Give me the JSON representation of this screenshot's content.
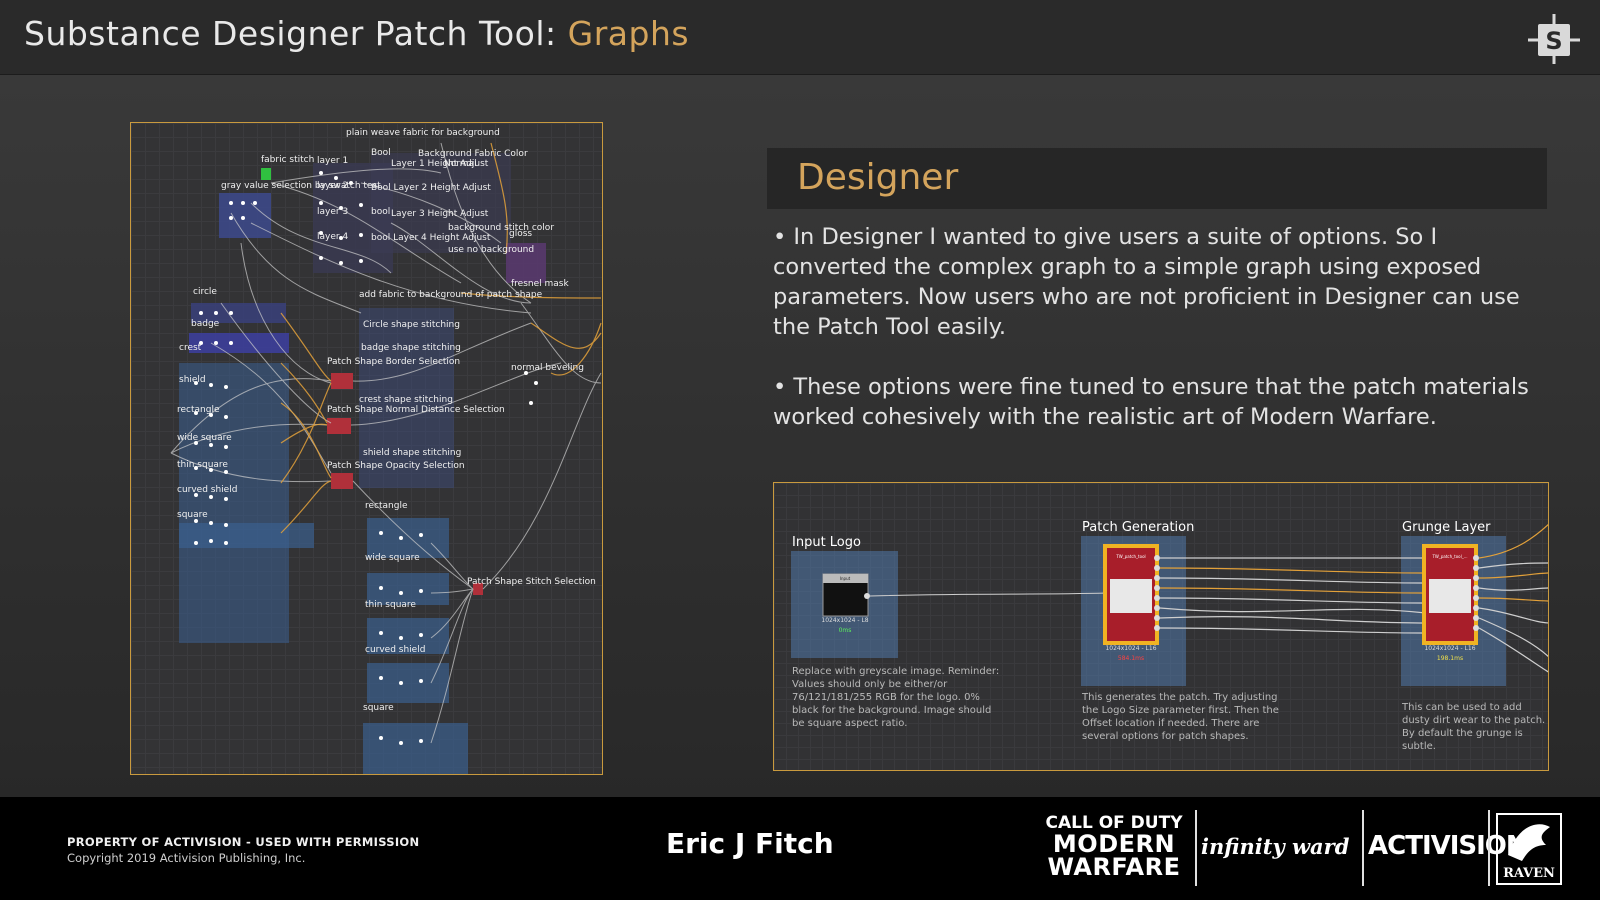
{
  "header": {
    "title_main": "Substance Designer Patch Tool: ",
    "title_accent": "Graphs",
    "logo_icon": "substance-s-logo",
    "accent_color": "#d4a45c"
  },
  "graph_panel": {
    "labels": [
      "plain weave fabric for background",
      "Bool",
      "Background Fabric Color",
      "fabric stitch",
      "layer 1",
      "Layer 1 Height Adjust",
      "Normal",
      "gray value selection by swatch test",
      "layer 2",
      "Bool Layer 2 Height Adjust",
      "layer 3",
      "bool",
      "Layer 3 Height Adjust",
      "background stitch color",
      "gloss",
      "layer 4",
      "bool Layer 4 Height Adjust",
      "use no background",
      "fresnel mask",
      "circle",
      "add fabric to background of patch shape",
      "badge",
      "Circle shape stitching",
      "crest",
      "badge shape stitching",
      "Patch Shape Border Selection",
      "normal beveling",
      "shield",
      "rectangle",
      "crest shape stitching",
      "Patch Shape Normal Distance Selection",
      "wide square",
      "shield shape stitching",
      "thin square",
      "Patch Shape Opacity Selection",
      "curved shield",
      "square",
      "rectangle",
      "wide square",
      "Patch Shape Stitch Selection",
      "thin square",
      "curved shield",
      "square"
    ]
  },
  "designer": {
    "heading": "Designer",
    "bullets": [
      "• In Designer I wanted to give users a suite of options. So I converted the complex graph to a simple graph using exposed parameters. Now users who are not proficient in Designer can use the Patch Tool easily.",
      "• These options were fine tuned to ensure that the patch materials worked cohesively with the realistic art of Modern Warfare."
    ]
  },
  "mini_graph": {
    "frames": [
      {
        "title": "Input Logo",
        "node_header": "Input",
        "node_info": "1024x1024 - L8",
        "node_time": "0ms",
        "note": "Replace with greyscale image. Reminder: Values should only be either/or 76/121/181/255 RGB for the logo. 0% black for the background. Image should be square aspect ratio."
      },
      {
        "title": "Patch Generation",
        "node_header": "TW_patch_tool",
        "node_info": "1024x1024 - L16",
        "node_time": "584.1ms",
        "note": "This generates the patch. Try adjusting the Logo Size parameter first. Then the Offset location if needed. There are several options for patch shapes."
      },
      {
        "title": "Grunge Layer",
        "node_header": "TW_patch_tool_...",
        "node_info": "1024x1024 - L16",
        "node_time": "198.1ms",
        "note": "This can be used to add dusty dirt wear to the patch. By default the grunge is subtle."
      }
    ]
  },
  "footer": {
    "property": "PROPERTY OF ACTIVISION - USED WITH PERMISSION",
    "copyright": "Copyright 2019 Activision Publishing, Inc.",
    "author": "Eric J Fitch",
    "cod_line1": "CALL OF DUTY",
    "cod_line2": "MODERN",
    "cod_line3": "WARFARE",
    "iw": "infinity ward",
    "activision": "ACTIVISION",
    "raven": "RAVEN"
  }
}
